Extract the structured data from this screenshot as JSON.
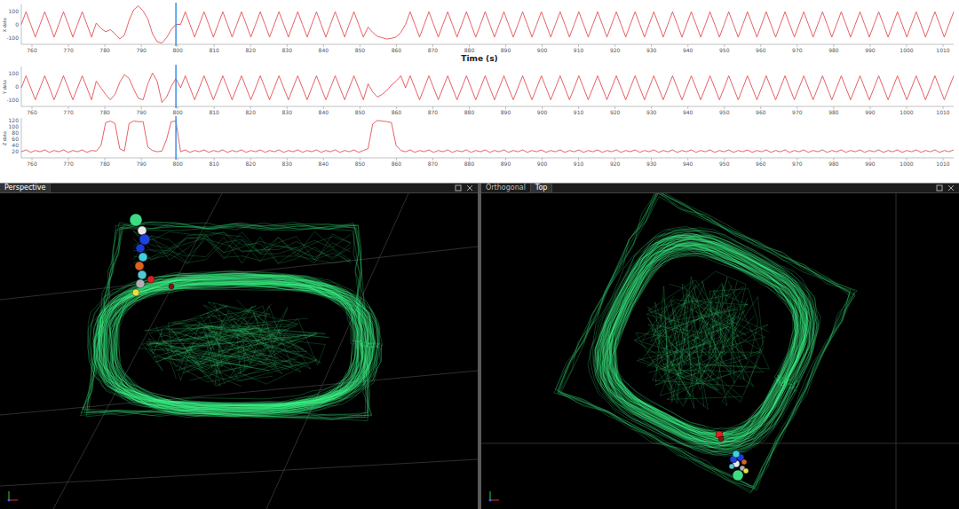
{
  "x_label": "Time (s)",
  "x_ticks": [
    "760",
    "770",
    "780",
    "790",
    "800",
    "810",
    "820",
    "830",
    "840",
    "850",
    "860",
    "870",
    "880",
    "890",
    "900",
    "910",
    "920",
    "930",
    "940",
    "950",
    "960",
    "970",
    "980",
    "990",
    "1000",
    "1010"
  ],
  "cursor_index": 33,
  "charts": [
    {
      "y_label": "X data",
      "y_ticks": [
        "100",
        "0",
        "-100"
      ],
      "y_min": -150,
      "y_max": 150,
      "values": [
        0,
        95,
        0,
        -95,
        0,
        95,
        0,
        -95,
        0,
        95,
        0,
        -95,
        0,
        95,
        0,
        -95,
        10,
        -30,
        -55,
        -40,
        -70,
        -110,
        -80,
        30,
        110,
        140,
        100,
        40,
        -70,
        -130,
        -140,
        -100,
        -40,
        0,
        0,
        95,
        0,
        -95,
        0,
        95,
        0,
        -95,
        0,
        95,
        0,
        -95,
        0,
        95,
        0,
        -95,
        0,
        95,
        0,
        -95,
        0,
        95,
        0,
        -95,
        0,
        95,
        0,
        -95,
        0,
        95,
        0,
        -95,
        0,
        95,
        0,
        -95,
        0,
        95,
        0,
        -95,
        -20,
        -60,
        -90,
        -100,
        -110,
        -105,
        -95,
        -60,
        0,
        95,
        0,
        -95,
        0,
        95,
        0,
        -95,
        0,
        95,
        0,
        -95,
        0,
        95,
        0,
        -95,
        0,
        95,
        0,
        -95,
        0,
        95,
        0,
        -95,
        0,
        95,
        0,
        -95,
        0,
        95,
        0,
        -95,
        0,
        95,
        0,
        -95,
        0,
        95,
        0,
        -95,
        0,
        95,
        0,
        -95,
        0,
        95,
        0,
        -95,
        0,
        95,
        0,
        -95,
        0,
        95,
        0,
        -95,
        0,
        95,
        0,
        -95,
        0,
        95,
        0,
        -95,
        0,
        95,
        0,
        -95,
        0,
        95,
        0,
        -95,
        0,
        95,
        0,
        -95,
        0,
        95,
        0,
        -95,
        0,
        95,
        0,
        -95,
        0,
        95,
        0,
        -95,
        0,
        95,
        0,
        -95,
        0,
        95,
        0,
        -95,
        0,
        95,
        0,
        -95,
        0,
        95,
        0,
        -95,
        0,
        95,
        0,
        -95,
        0,
        95,
        0,
        -95,
        0,
        95,
        0,
        -95,
        0,
        95
      ]
    },
    {
      "y_label": "Y data",
      "y_ticks": [
        "100",
        "0",
        "-100"
      ],
      "y_min": -150,
      "y_max": 150,
      "values": [
        -10,
        80,
        -10,
        -100,
        -10,
        80,
        -10,
        -100,
        -10,
        80,
        -10,
        -100,
        -10,
        80,
        -10,
        -100,
        40,
        -10,
        -60,
        -100,
        -60,
        30,
        90,
        60,
        -20,
        -90,
        -100,
        20,
        100,
        40,
        -120,
        -80,
        0,
        60,
        -10,
        80,
        -10,
        -100,
        -10,
        80,
        -10,
        -100,
        -10,
        80,
        -10,
        -100,
        -10,
        80,
        -10,
        -100,
        -10,
        80,
        -10,
        -100,
        -10,
        80,
        -10,
        -100,
        -10,
        80,
        -10,
        -100,
        -10,
        80,
        -10,
        -100,
        -10,
        80,
        -10,
        -100,
        -10,
        80,
        -10,
        -100,
        20,
        -40,
        -80,
        -60,
        -30,
        10,
        40,
        80,
        -10,
        80,
        -10,
        -100,
        -10,
        80,
        -10,
        -100,
        -10,
        80,
        -10,
        -100,
        -10,
        80,
        -10,
        -100,
        -10,
        80,
        -10,
        -100,
        -10,
        80,
        -10,
        -100,
        -10,
        80,
        -10,
        -100,
        -10,
        80,
        -10,
        -100,
        -10,
        80,
        -10,
        -100,
        -10,
        80,
        -10,
        -100,
        -10,
        80,
        -10,
        -100,
        -10,
        80,
        -10,
        -100,
        -10,
        80,
        -10,
        -100,
        -10,
        80,
        -10,
        -100,
        -10,
        80,
        -10,
        -100,
        -10,
        80,
        -10,
        -100,
        -10,
        80,
        -10,
        -100,
        -10,
        80,
        -10,
        -100,
        -10,
        80,
        -10,
        -100,
        -10,
        80,
        -10,
        -100,
        -10,
        80,
        -10,
        -100,
        -10,
        80,
        -10,
        -100,
        -10,
        80,
        -10,
        -100,
        -10,
        80,
        -10,
        -100,
        -10,
        80,
        -10,
        -100,
        -10,
        80,
        -10,
        -100,
        -10,
        80,
        -10,
        -100,
        -10,
        80,
        -10,
        -100,
        -10,
        80,
        -10,
        -100,
        -10,
        80
      ]
    },
    {
      "y_label": "Z data",
      "y_ticks": [
        "120",
        "100",
        "80",
        "60",
        "40",
        "20"
      ],
      "y_min": 0,
      "y_max": 130,
      "values": [
        20,
        26,
        18,
        24,
        20,
        26,
        18,
        24,
        20,
        26,
        18,
        24,
        20,
        26,
        18,
        24,
        22,
        40,
        115,
        120,
        112,
        30,
        22,
        112,
        120,
        118,
        118,
        35,
        24,
        20,
        22,
        60,
        118,
        120,
        20,
        26,
        18,
        24,
        20,
        26,
        18,
        24,
        20,
        26,
        18,
        24,
        20,
        26,
        18,
        24,
        20,
        26,
        18,
        24,
        20,
        26,
        18,
        24,
        20,
        26,
        18,
        24,
        20,
        26,
        18,
        24,
        20,
        26,
        18,
        24,
        20,
        26,
        18,
        24,
        30,
        110,
        122,
        120,
        118,
        115,
        40,
        24,
        20,
        26,
        18,
        24,
        20,
        26,
        18,
        24,
        20,
        26,
        18,
        24,
        20,
        26,
        18,
        24,
        20,
        26,
        18,
        24,
        20,
        26,
        18,
        24,
        20,
        26,
        18,
        24,
        20,
        26,
        18,
        24,
        20,
        26,
        18,
        24,
        20,
        26,
        18,
        24,
        20,
        26,
        18,
        24,
        20,
        26,
        18,
        24,
        20,
        26,
        18,
        24,
        20,
        26,
        18,
        24,
        20,
        26,
        18,
        24,
        20,
        26,
        18,
        24,
        20,
        26,
        18,
        24,
        20,
        26,
        18,
        24,
        20,
        26,
        18,
        24,
        20,
        26,
        18,
        24,
        20,
        26,
        18,
        24,
        20,
        26,
        18,
        24,
        20,
        26,
        18,
        24,
        20,
        26,
        18,
        24,
        20,
        26,
        18,
        24,
        20,
        26,
        18,
        24,
        20,
        26,
        18,
        24,
        20,
        26,
        18,
        24,
        20,
        26,
        18,
        24,
        20,
        26
      ]
    }
  ],
  "views": [
    {
      "tabs": [
        {
          "label": "Perspective",
          "selected": true
        }
      ]
    },
    {
      "tabs": [
        {
          "label": "Orthogonal",
          "selected": false
        },
        {
          "label": "Top",
          "selected": true
        }
      ]
    }
  ],
  "markers": [
    {
      "color": "#3ddc84"
    },
    {
      "color": "#e8e8e8"
    },
    {
      "color": "#2040e0"
    },
    {
      "color": "#1a3ad0"
    },
    {
      "color": "#40d0e0"
    },
    {
      "color": "#e06020"
    },
    {
      "color": "#50c8d8"
    },
    {
      "color": "#b0b0b0"
    },
    {
      "color": "#e8e040"
    },
    {
      "color": "#e02020"
    },
    {
      "color": "#8a1010"
    }
  ]
}
